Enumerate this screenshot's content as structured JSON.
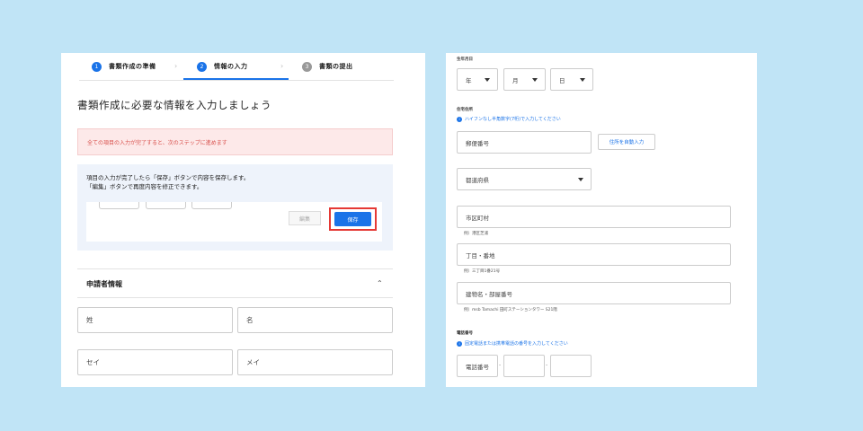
{
  "stepper": {
    "steps": [
      {
        "num": "1",
        "label": "書類作成の準備"
      },
      {
        "num": "2",
        "label": "情報の入力"
      },
      {
        "num": "3",
        "label": "書類の提出"
      }
    ],
    "chevron": "›",
    "active_index": 1
  },
  "page_heading": "書類作成に必要な情報を入力しましょう",
  "alert_text": "全ての項目の入力が完了すると、次のステップに進めます",
  "info": {
    "line1": "項目の入力が完了したら「保存」ボタンで内容を保存します。",
    "line2": "「編集」ボタンで再度内容を修正できます。"
  },
  "buttons": {
    "edit": "編集",
    "save": "保存",
    "autofill": "住所を自動入力"
  },
  "applicant_section": {
    "title": "申請者情報",
    "chevron": "⌃",
    "placeholders": {
      "last_name": "姓",
      "first_name": "名",
      "last_name_kana": "セイ",
      "first_name_kana": "メイ"
    }
  },
  "birthdate": {
    "label": "生年月日",
    "year": "年",
    "month": "月",
    "day": "日"
  },
  "address": {
    "label": "住宅住所",
    "hint": "ハイフンなし半角数字(7桁)で入力してください",
    "postal": "郵便番号",
    "prefecture": "都道府県",
    "city": "市区町村",
    "city_example": "例）港区芝浦",
    "block": "丁目・番地",
    "block_example": "例）三丁目1番21号",
    "building": "建物名・部屋番号",
    "building_example": "例）msb Tamachi 田町ステーションタワー S21階"
  },
  "phone": {
    "label": "電話番号",
    "hint": "固定電話または携帯電話の番号を入力してください",
    "placeholder": "電話番号",
    "separator": "-"
  },
  "colors": {
    "accent": "#1a73e8",
    "background": "#c0e4f6",
    "alert": "#fde9e9",
    "highlight": "#e53935"
  }
}
